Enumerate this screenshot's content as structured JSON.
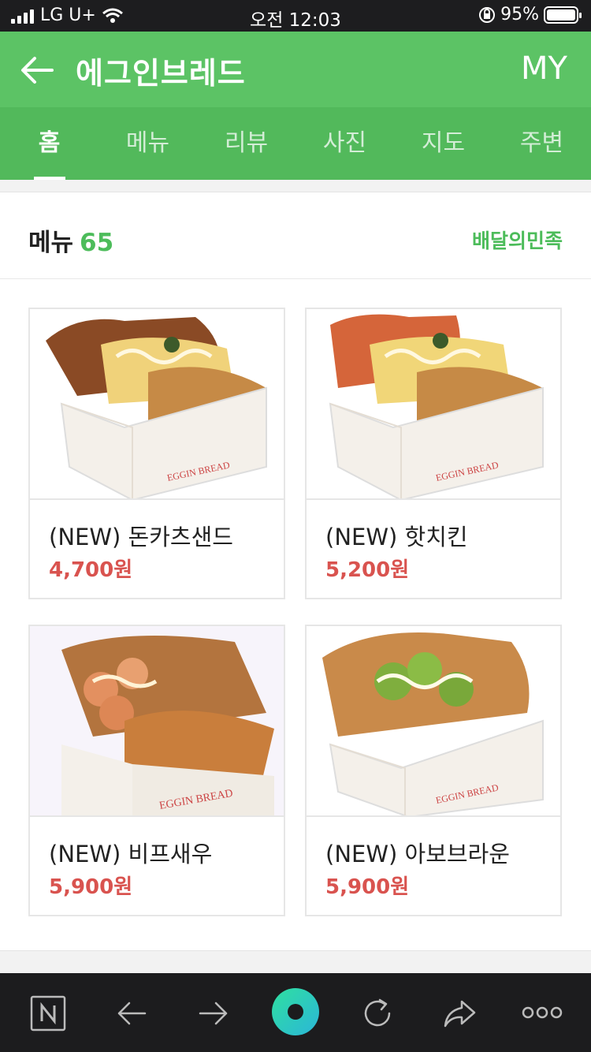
{
  "status": {
    "carrier": "LG U+",
    "time": "오전 12:03",
    "battery": "95%"
  },
  "header": {
    "title": "에그인브레드",
    "my_label": "MY"
  },
  "tabs": [
    {
      "label": "홈"
    },
    {
      "label": "메뉴"
    },
    {
      "label": "리뷰"
    },
    {
      "label": "사진"
    },
    {
      "label": "지도"
    },
    {
      "label": "주변"
    }
  ],
  "menu": {
    "title": "메뉴",
    "count": "65",
    "delivery_link": "배달의민족",
    "items": [
      {
        "name": "(NEW) 돈카츠샌드",
        "price": "4,700원"
      },
      {
        "name": "(NEW) 핫치킨",
        "price": "5,200원"
      },
      {
        "name": "(NEW) 비프새우",
        "price": "5,900원"
      },
      {
        "name": "(NEW) 아보브라운",
        "price": "5,900원"
      }
    ]
  },
  "toolbar": {
    "icons": [
      "naver-n-icon",
      "back-arrow-icon",
      "forward-arrow-icon",
      "home-dot-icon",
      "refresh-icon",
      "share-icon",
      "more-icon"
    ]
  },
  "colors": {
    "brand_green": "#5cc365",
    "price_red": "#d9534f"
  }
}
